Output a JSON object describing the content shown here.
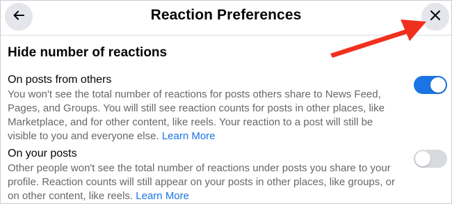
{
  "header": {
    "title": "Reaction Preferences",
    "back_icon": "arrow-left-icon",
    "close_icon": "close-icon"
  },
  "section": {
    "title": "Hide number of reactions"
  },
  "settings": [
    {
      "title": "On posts from others",
      "description": "You won't see the total number of reactions for posts others share to News Feed, Pages, and Groups. You will still see reaction counts for posts in other places, like Marketplace, and for other content, like reels. Your reaction to a post will still be visible to you and everyone else.",
      "learn_more": "Learn More",
      "enabled": true
    },
    {
      "title": "On your posts",
      "description": "Other people won't see the total number of reactions under posts you share to your profile. Reaction counts will still appear on your posts in other places, like groups, or on other content, like reels.",
      "learn_more": "Learn More",
      "enabled": false
    }
  ],
  "colors": {
    "accent": "#1b74e4",
    "toggle_off": "#d8dadf",
    "annotation_arrow": "#f0301e"
  }
}
